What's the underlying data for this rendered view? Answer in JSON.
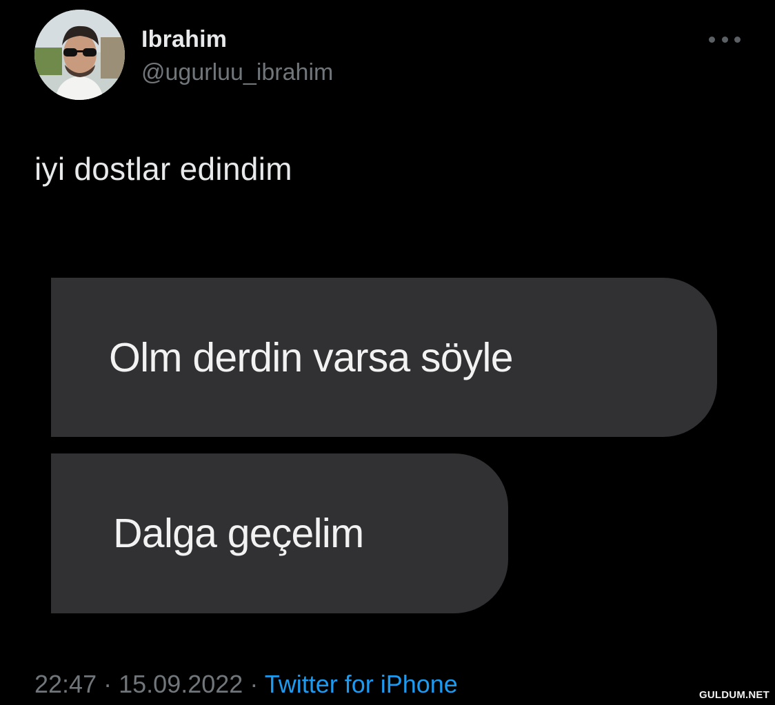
{
  "author": {
    "display_name": "Ibrahim",
    "handle": "@ugurluu_ibrahim"
  },
  "tweet": {
    "text": "iyi dostlar edindim",
    "messages": [
      "Olm derdin varsa söyle",
      "Dalga geçelim"
    ]
  },
  "meta": {
    "time": "22:47",
    "separator": "·",
    "date": "15.09.2022",
    "source": "Twitter for iPhone"
  },
  "watermark": "GULDUM.NET",
  "icons": {
    "more": "more-horizontal-icon"
  },
  "colors": {
    "background": "#000000",
    "primary_text": "#e7e9ea",
    "secondary_text": "#71767b",
    "link": "#1d9bf0",
    "bubble": "#313134"
  }
}
